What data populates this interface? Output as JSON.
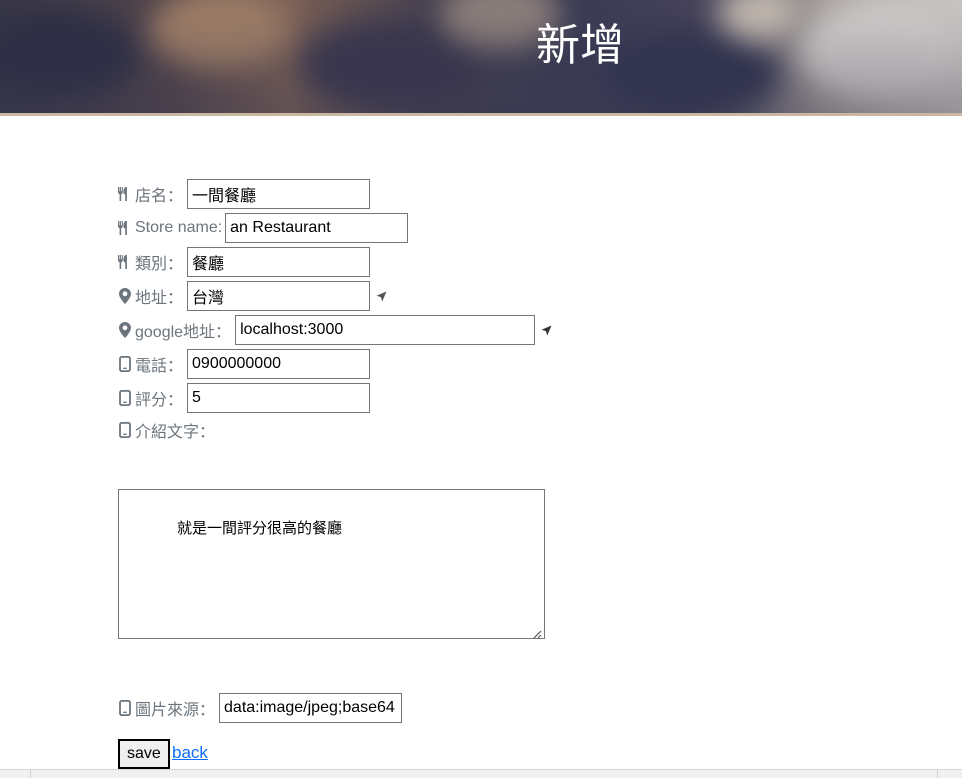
{
  "header": {
    "title": "新增"
  },
  "form": {
    "name": {
      "label": "店名：",
      "value": "一間餐廳",
      "icon": "utensils-icon"
    },
    "name_en": {
      "label": "Store name:",
      "value": "an Restaurant",
      "icon": "utensils-icon"
    },
    "category": {
      "label": "類別：",
      "value": "餐廳",
      "icon": "utensils-icon"
    },
    "location": {
      "label": "地址：",
      "value": "台灣",
      "icon": "map-marker-icon",
      "action_icon": "location-arrow-icon"
    },
    "google_map": {
      "label": "google地址：",
      "value": "localhost:3000",
      "icon": "map-marker-icon",
      "action_icon": "location-arrow-icon"
    },
    "phone": {
      "label": "電話：",
      "value": "0900000000",
      "icon": "mobile-icon"
    },
    "rating": {
      "label": "評分：",
      "value": "5",
      "icon": "mobile-icon"
    },
    "description": {
      "label": "介紹文字：",
      "value": "就是一間評分很高的餐廳",
      "icon": "mobile-icon"
    },
    "image": {
      "label": "圖片來源：",
      "value": "data:image/jpeg;base64",
      "icon": "mobile-icon"
    }
  },
  "actions": {
    "save_label": "save",
    "back_label": "back"
  },
  "colors": {
    "label_gray": "#6c757d",
    "link_blue": "#0d6efd"
  }
}
